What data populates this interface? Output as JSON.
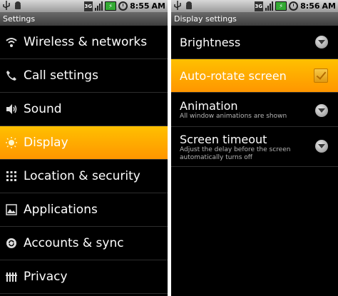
{
  "left_screen": {
    "status": {
      "time": "8:55",
      "ampm": "AM",
      "network": "3G"
    },
    "title": "Settings",
    "items": [
      {
        "label": "Wireless & networks",
        "icon": "wifi-icon"
      },
      {
        "label": "Call settings",
        "icon": "phone-icon"
      },
      {
        "label": "Sound",
        "icon": "speaker-icon"
      },
      {
        "label": "Display",
        "icon": "brightness-icon",
        "selected": true
      },
      {
        "label": "Location & security",
        "icon": "keypad-icon"
      },
      {
        "label": "Applications",
        "icon": "applications-icon"
      },
      {
        "label": "Accounts & sync",
        "icon": "sync-icon"
      },
      {
        "label": "Privacy",
        "icon": "privacy-icon"
      }
    ]
  },
  "right_screen": {
    "status": {
      "time": "8:56",
      "ampm": "AM",
      "network": "3G"
    },
    "title": "Display settings",
    "items": [
      {
        "label": "Brightness",
        "control": "dropdown"
      },
      {
        "label": "Auto-rotate screen",
        "control": "checkbox",
        "checked": true,
        "selected": true
      },
      {
        "label": "Animation",
        "sub": "All window animations are shown",
        "control": "dropdown"
      },
      {
        "label": "Screen timeout",
        "sub": "Adjust the delay before the screen automatically turns off",
        "control": "dropdown"
      }
    ]
  },
  "colors": {
    "highlight": "#ffa500",
    "background": "#000000"
  }
}
